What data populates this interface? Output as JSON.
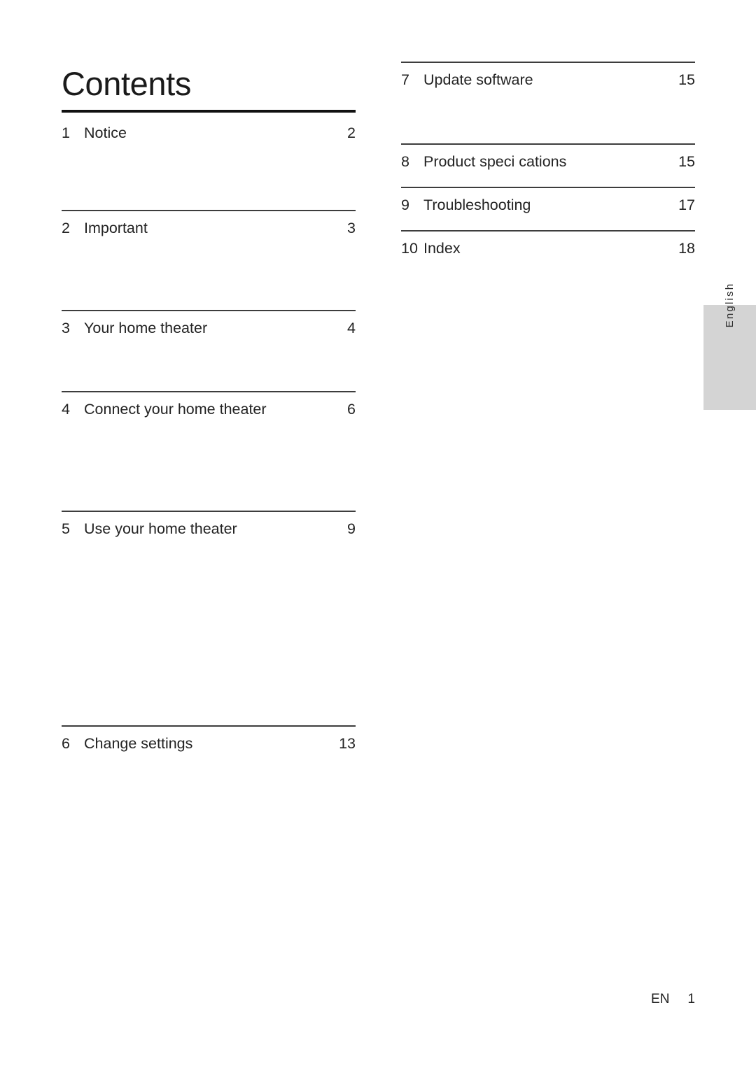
{
  "page": {
    "title": "Contents",
    "language_tab": "English",
    "footer": {
      "locale_code": "EN",
      "page_number": "1"
    }
  },
  "toc": {
    "left_column": [
      {
        "number": "1",
        "label": "Notice",
        "page": "2"
      },
      {
        "number": "2",
        "label": "Important",
        "page": "3"
      },
      {
        "number": "3",
        "label": "Your home theater",
        "page": "4"
      },
      {
        "number": "4",
        "label": "Connect your home theater",
        "page": "6"
      },
      {
        "number": "5",
        "label": "Use your home theater",
        "page": "9"
      },
      {
        "number": "6",
        "label": "Change settings",
        "page": "13"
      }
    ],
    "right_column": [
      {
        "number": "7",
        "label": "Update software",
        "page": "15"
      },
      {
        "number": "8",
        "label": "Product speci cations",
        "page": "15"
      },
      {
        "number": "9",
        "label": "Troubleshooting",
        "page": "17"
      },
      {
        "number": "10",
        "label": "Index",
        "page": "18"
      }
    ]
  },
  "colors": {
    "page_background": "#ffffff",
    "text": "#232323",
    "title_rule": "#111111",
    "entry_rule": "#3d3d3d",
    "language_tab_background": "#d4d4d4"
  }
}
